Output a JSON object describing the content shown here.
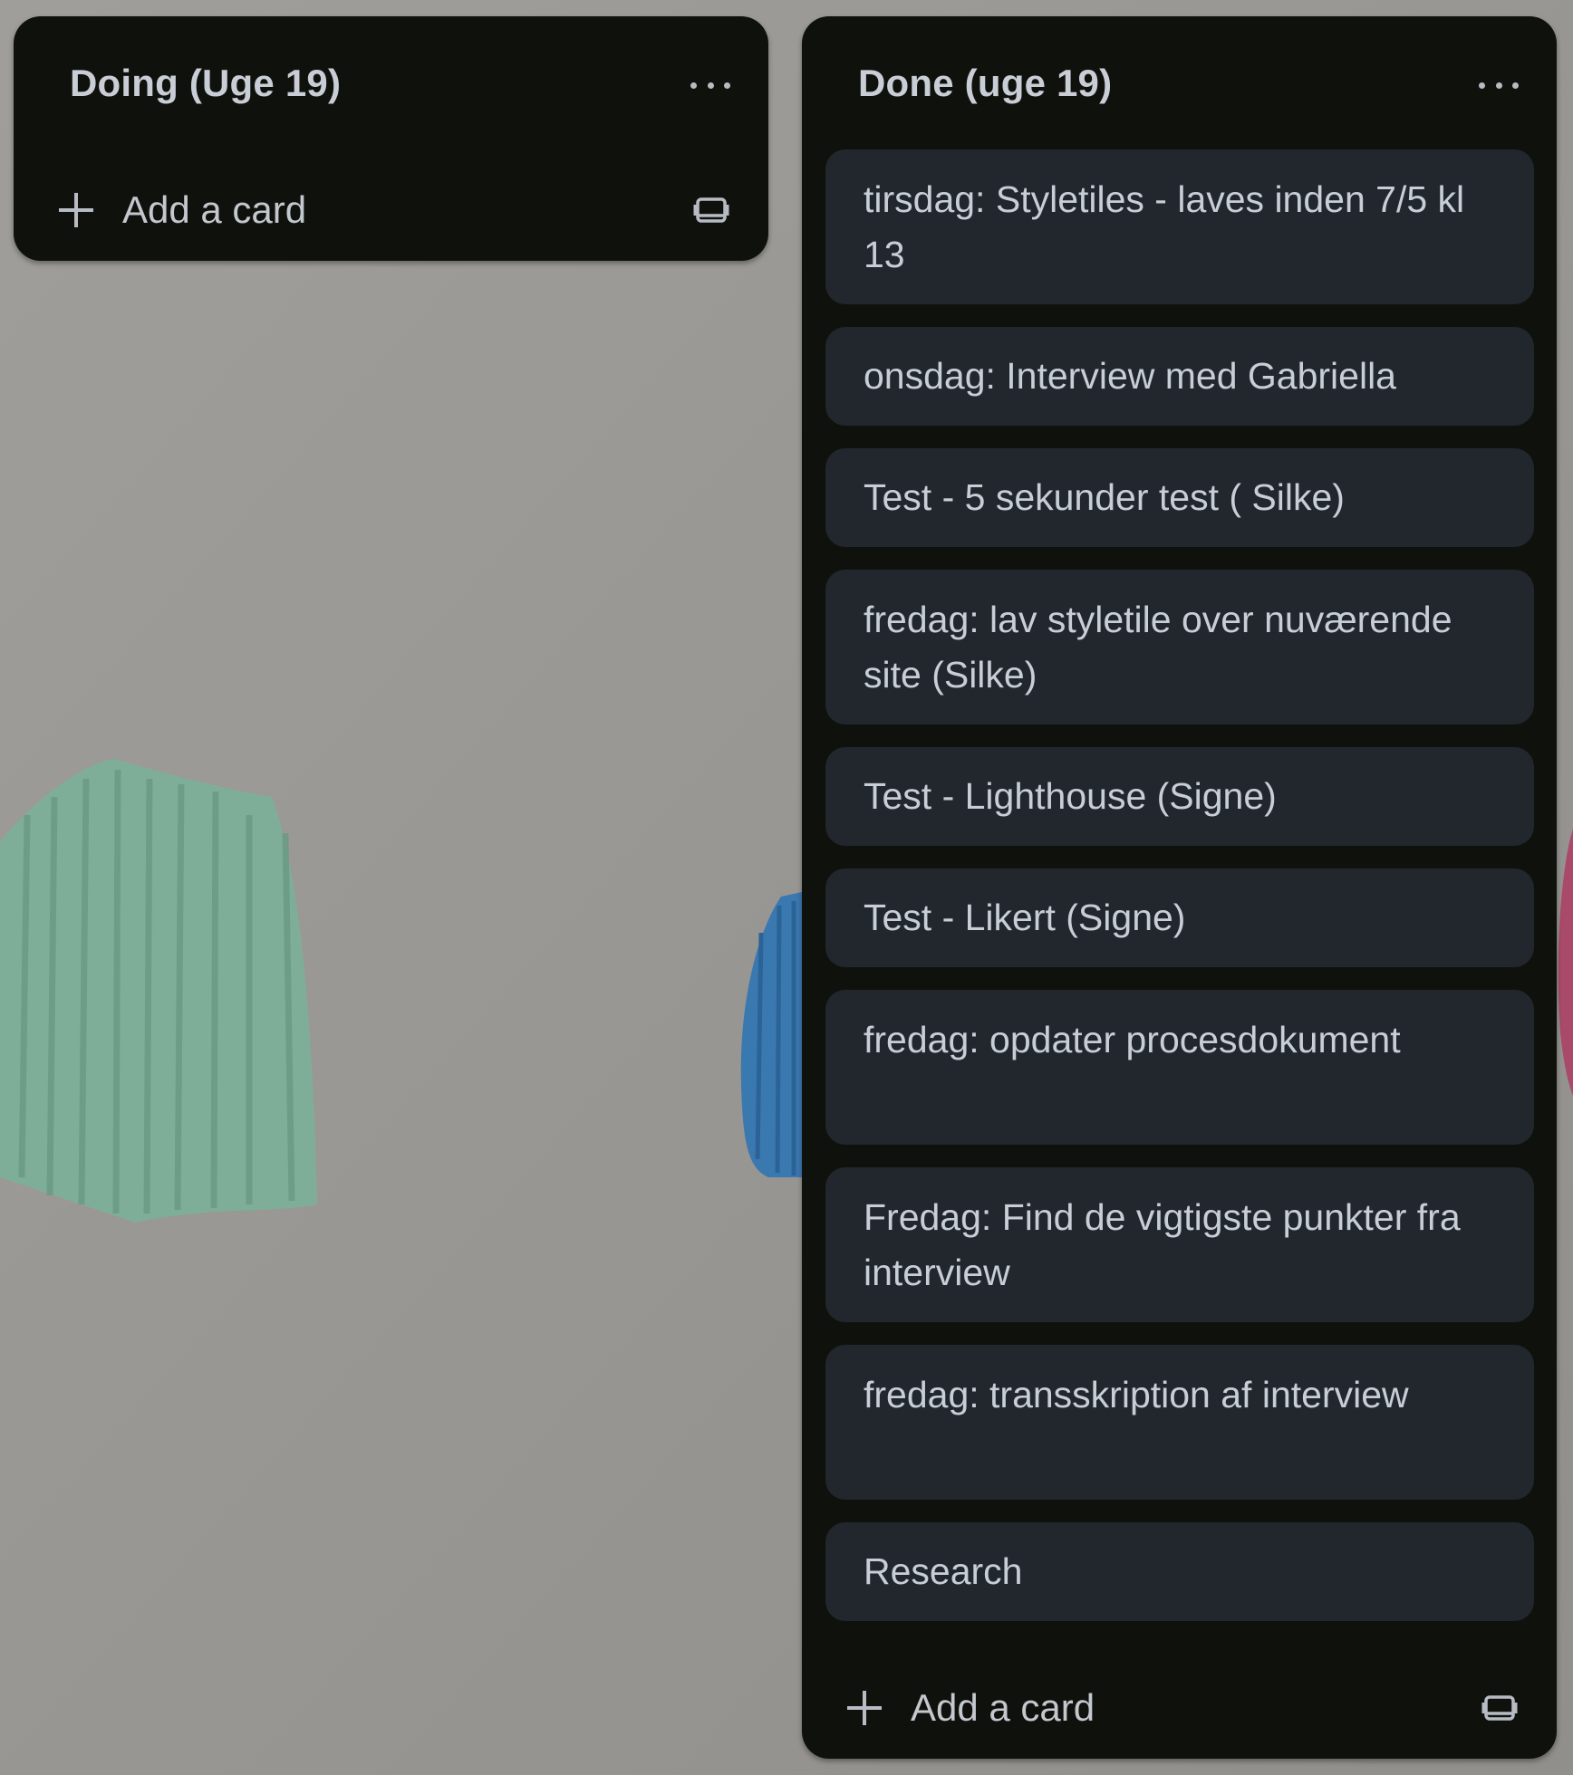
{
  "lists": [
    {
      "title": "Doing (Uge 19)",
      "add_card_label": "Add a card",
      "cards": []
    },
    {
      "title": "Done (uge 19)",
      "add_card_label": "Add a card",
      "cards": [
        "tirsdag: Styletiles - laves inden 7/5 kl 13",
        "onsdag: Interview med Gabriella",
        "Test - 5 sekunder test ( Silke)",
        "fredag: lav styletile over nuværende site (Silke)",
        "Test - Lighthouse (Signe)",
        "Test - Likert (Signe)",
        "fredag: opdater procesdokument",
        "Fredag: Find de vigtigste punkter fra interview",
        "fredag: transskription af interview",
        "Research"
      ]
    }
  ],
  "icons": {
    "menu": "ellipsis-icon",
    "add": "plus-icon",
    "template": "card-template-icon"
  },
  "colors": {
    "list_background": "#0f120c",
    "card_background": "#22272e",
    "text": "#c8ced6",
    "board_background": "#9a9894"
  }
}
